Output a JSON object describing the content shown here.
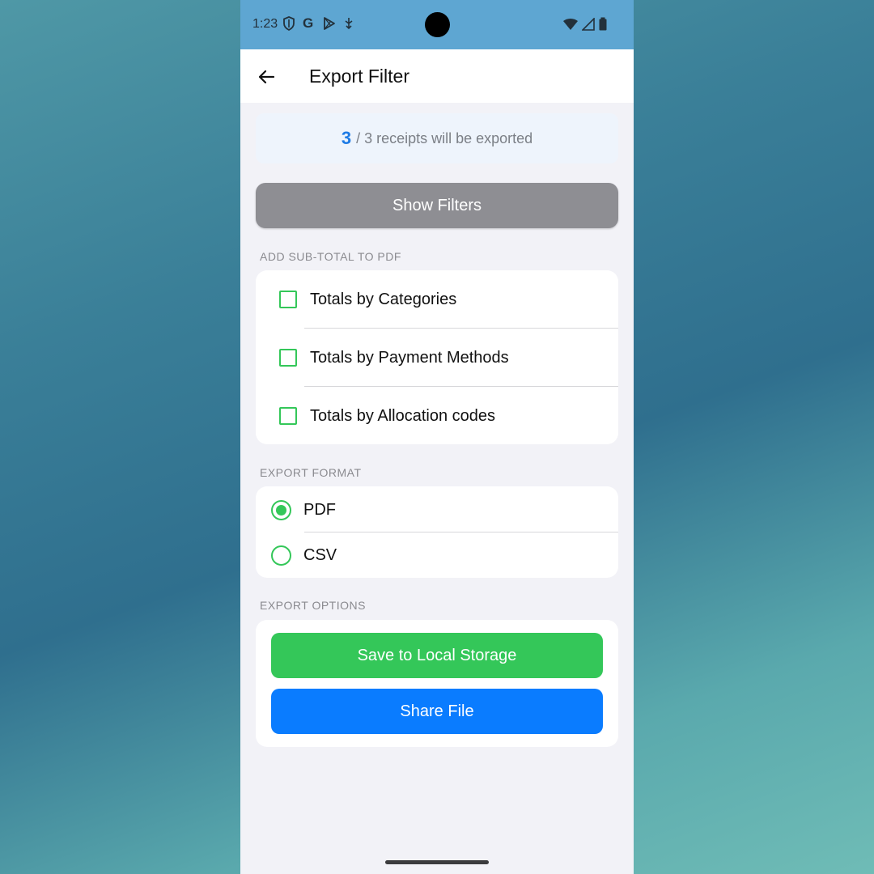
{
  "status_bar": {
    "time": "1:23",
    "left_icons": [
      "shield-icon",
      "google-icon",
      "play-store-icon",
      "usb-debug-icon"
    ],
    "right_icons": [
      "wifi-icon",
      "cellular-signal-icon",
      "battery-icon"
    ]
  },
  "app_bar": {
    "title": "Export Filter",
    "back_icon": "arrow-left-icon"
  },
  "summary": {
    "selected_count": "3",
    "rest_text": "/ 3 receipts will be exported"
  },
  "show_filters_label": "Show Filters",
  "subtotal_section": {
    "header": "ADD SUB-TOTAL TO PDF",
    "options": [
      {
        "label": "Totals by Categories",
        "checked": false
      },
      {
        "label": "Totals by Payment Methods",
        "checked": false
      },
      {
        "label": "Totals by Allocation codes",
        "checked": false
      }
    ]
  },
  "format_section": {
    "header": "EXPORT FORMAT",
    "options": [
      {
        "label": "PDF",
        "selected": true
      },
      {
        "label": "CSV",
        "selected": false
      }
    ]
  },
  "options_section": {
    "header": "EXPORT OPTIONS",
    "save_label": "Save to Local Storage",
    "share_label": "Share File"
  },
  "colors": {
    "accent_green": "#34c759",
    "accent_blue": "#0a7cff",
    "count_blue": "#1e7be5",
    "status_bar": "#5ea6d2",
    "filter_button": "#8e8e93"
  }
}
